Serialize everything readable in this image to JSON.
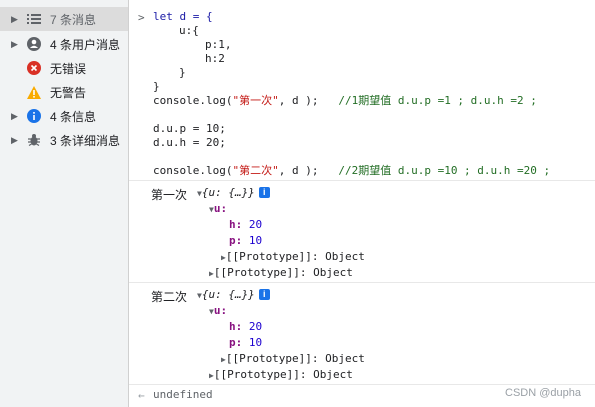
{
  "sidebar": {
    "items": [
      {
        "label": "7 条消息",
        "icon": "list-icon",
        "has_arrow": true,
        "selected": true
      },
      {
        "label": "4 条用户消息",
        "icon": "user-icon",
        "has_arrow": true,
        "selected": false
      },
      {
        "label": "无错误",
        "icon": "error-icon",
        "has_arrow": false,
        "selected": false
      },
      {
        "label": "无警告",
        "icon": "warning-icon",
        "has_arrow": false,
        "selected": false
      },
      {
        "label": "4 条信息",
        "icon": "info-icon",
        "has_arrow": true,
        "selected": false
      },
      {
        "label": "3 条详细消息",
        "icon": "bug-icon",
        "has_arrow": true,
        "selected": false
      }
    ]
  },
  "console": {
    "prompt": ">",
    "code": {
      "l1": "let d = {",
      "l2": "u:{",
      "l3": "p:1,",
      "l4": "h:2",
      "l5": "}",
      "l6": "}",
      "l7_fn": "console.log(",
      "l7_str": "\"第一次\"",
      "l7_rest": ", d );   ",
      "l7_cmt": "//1期望值 d.u.p =1 ; d.u.h =2 ;",
      "l8": "d.u.p = 10;",
      "l9": "d.u.h = 20;",
      "l10_fn": "console.log(",
      "l10_str": "\"第二次\"",
      "l10_rest": ", d );   ",
      "l10_cmt": "//2期望值 d.u.p =10 ; d.u.h =20 ;"
    },
    "logs": [
      {
        "label": "第一次",
        "preview": "{u: {…}}",
        "key_u": "u:",
        "key_h": "h:",
        "val_h": "20",
        "key_p": "p:",
        "val_p": "10",
        "proto_inner": "[[Prototype]]: Object",
        "proto_outer": "[[Prototype]]: Object"
      },
      {
        "label": "第二次",
        "preview": "{u: {…}}",
        "key_u": "u:",
        "key_h": "h:",
        "val_h": "20",
        "key_p": "p:",
        "val_p": "10",
        "proto_inner": "[[Prototype]]: Object",
        "proto_outer": "[[Prototype]]: Object"
      }
    ],
    "return_arrow": "←",
    "return_value": "undefined",
    "info_glyph": "i"
  },
  "watermark": "CSDN @dupha",
  "colors": {
    "sidebar_bg": "#f1f3f4",
    "selected_bg": "#dcdcdc",
    "error": "#d93025",
    "warning": "#f9ab00",
    "info": "#1a73e8",
    "key": "#881280",
    "number": "#1c00cf",
    "string": "#c41a16",
    "comment": "#236e25"
  }
}
